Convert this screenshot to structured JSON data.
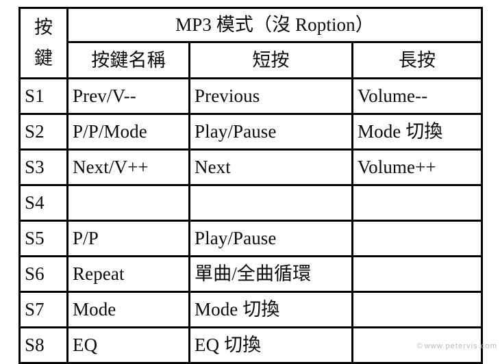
{
  "document": {
    "title": "MP3 模式（沒 Roption）",
    "watermark": {
      "mark": "©",
      "text": "www.petervis.com"
    }
  },
  "table": {
    "key_header": {
      "line1": "按",
      "line2": "鍵"
    },
    "column_headers": {
      "name": "按鍵名稱",
      "short_press": "短按",
      "long_press": "長按"
    },
    "rows": [
      {
        "key": "S1",
        "name": "Prev/V--",
        "short_press": "Previous",
        "long_press": "Volume--"
      },
      {
        "key": "S2",
        "name": "P/P/Mode",
        "short_press": "Play/Pause",
        "long_press": "Mode 切換"
      },
      {
        "key": "S3",
        "name": "Next/V++",
        "short_press": "Next",
        "long_press": "Volume++"
      },
      {
        "key": "S4",
        "name": "",
        "short_press": "",
        "long_press": ""
      },
      {
        "key": "S5",
        "name": "P/P",
        "short_press": "Play/Pause",
        "long_press": ""
      },
      {
        "key": "S6",
        "name": "Repeat",
        "short_press": "單曲/全曲循環",
        "long_press": ""
      },
      {
        "key": "S7",
        "name": "Mode",
        "short_press": "Mode 切換",
        "long_press": ""
      },
      {
        "key": "S8",
        "name": "EQ",
        "short_press": "EQ 切換",
        "long_press": ""
      }
    ]
  },
  "colors": {
    "background": "#ffffff",
    "border": "#000000",
    "text": "#0a0a0a",
    "watermark": "#b9b9b9"
  }
}
